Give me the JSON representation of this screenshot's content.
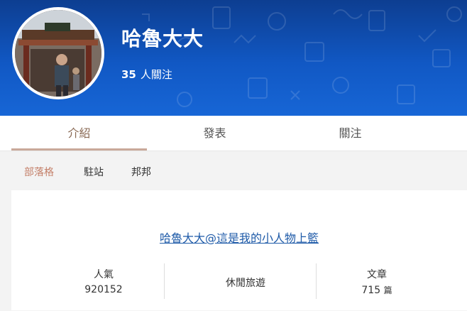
{
  "profile": {
    "name": "哈魯大大",
    "follow_count": "35",
    "follow_label": "人關注"
  },
  "tabs": [
    {
      "label": "介紹",
      "active": true
    },
    {
      "label": "發表",
      "active": false
    },
    {
      "label": "關注",
      "active": false
    }
  ],
  "subnav": [
    {
      "label": "部落格",
      "active": true
    },
    {
      "label": "駐站",
      "active": false
    },
    {
      "label": "邦邦",
      "active": false
    }
  ],
  "blog": {
    "title": "哈魯大大@這是我的小人物上籃",
    "popularity_label": "人氣",
    "popularity_value": "920152",
    "category": "休閒旅遊",
    "articles_label": "文章",
    "articles_value": "715",
    "articles_unit": "篇"
  },
  "colors": {
    "header_blue": "#1158c4",
    "active_tab": "#8a6a55",
    "active_subnav": "#c4806a",
    "link": "#1e5aa8"
  }
}
